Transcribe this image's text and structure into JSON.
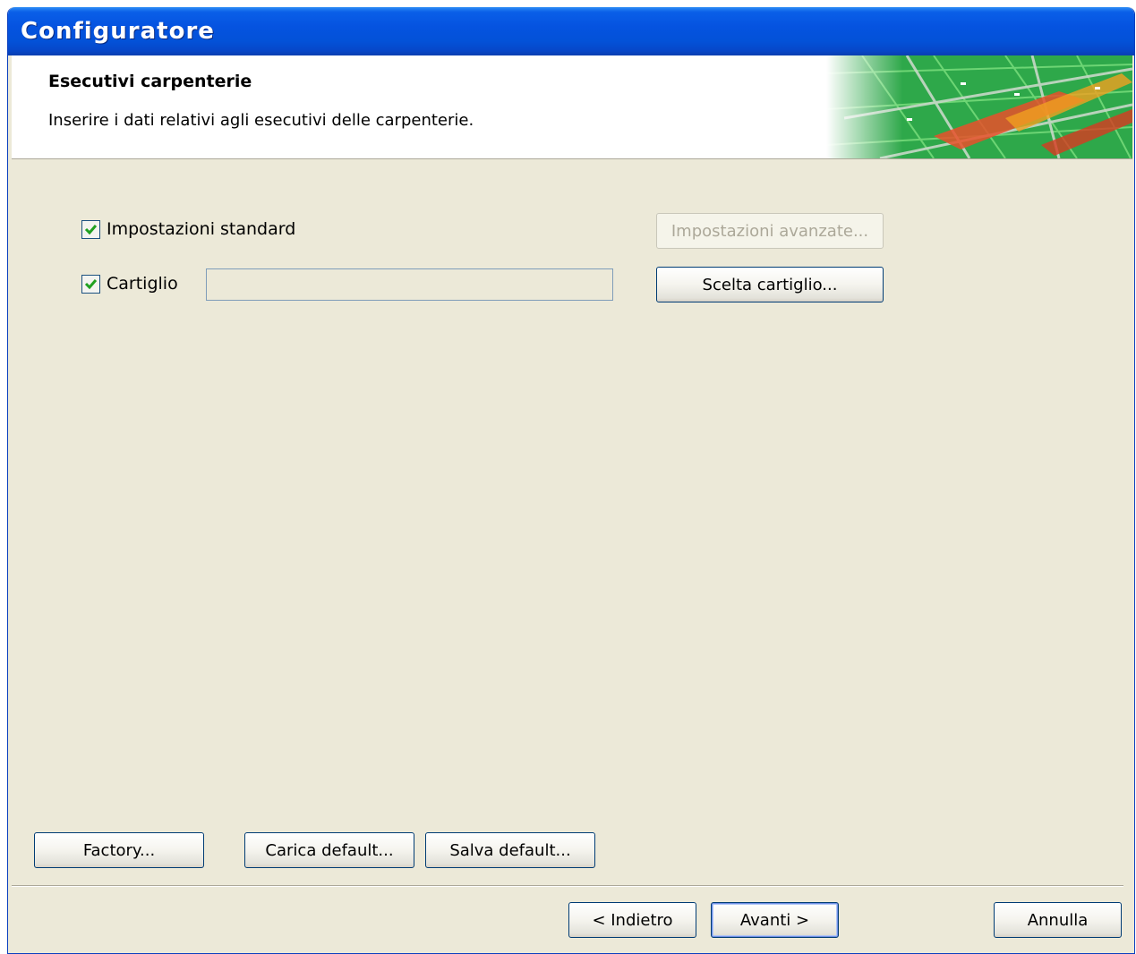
{
  "window": {
    "title": "Configuratore"
  },
  "header": {
    "title": "Esecutivi carpenterie",
    "description": "Inserire i dati relativi agli esecutivi delle carpenterie."
  },
  "options": {
    "standard_settings": {
      "label": "Impostazioni standard",
      "checked": true
    },
    "advanced_settings_button": "Impostazioni avanzate...",
    "title_block": {
      "label": "Cartiglio",
      "checked": true,
      "value": ""
    },
    "choose_title_block_button": "Scelta cartiglio..."
  },
  "defaults": {
    "factory": "Factory...",
    "load_default": "Carica default...",
    "save_default": "Salva default..."
  },
  "navigation": {
    "back": "< Indietro",
    "next": "Avanti >",
    "cancel": "Annulla"
  }
}
